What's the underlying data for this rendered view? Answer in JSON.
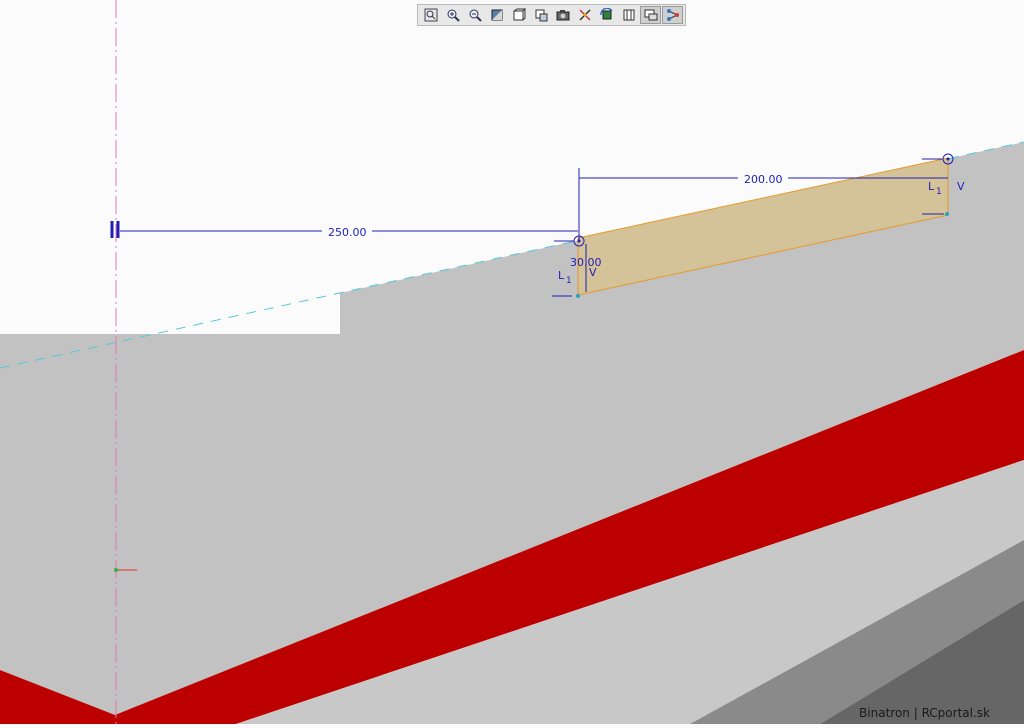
{
  "toolbar": {
    "buttons": [
      {
        "name": "zoom-extents",
        "icon": "zoom-extents-icon"
      },
      {
        "name": "zoom-in",
        "icon": "zoom-in-icon"
      },
      {
        "name": "zoom-out",
        "icon": "zoom-out-icon"
      },
      {
        "name": "view-3d",
        "icon": "view-cube-icon"
      },
      {
        "name": "view-orientation",
        "icon": "view-box-icon"
      },
      {
        "name": "view-settings",
        "icon": "view-settings-icon"
      },
      {
        "name": "snapshot",
        "icon": "camera-icon"
      },
      {
        "name": "snap-toggle",
        "icon": "snap-icon"
      },
      {
        "name": "rotate-view",
        "icon": "rotate-icon"
      },
      {
        "name": "section-view",
        "icon": "section-icon"
      },
      {
        "name": "display-mode",
        "icon": "display-mode-icon"
      },
      {
        "name": "connection-mode",
        "icon": "node-link-icon"
      }
    ]
  },
  "dimensions": {
    "offset_from_axis": "250.00",
    "width": "200.00",
    "height": "30.00"
  },
  "labels": {
    "left_segment": "L",
    "left_index": "1",
    "left_vertex": "V",
    "right_segment": "L",
    "right_index": "1",
    "right_vertex": "V"
  },
  "colors": {
    "slab_top": "#c2c2c2",
    "red_band": "#bc0000",
    "block_fill": "#d4c298",
    "block_edge": "#e59a2a",
    "dimension_line": "#1f1fb8"
  },
  "watermark": "Binatron | RCportal.sk"
}
